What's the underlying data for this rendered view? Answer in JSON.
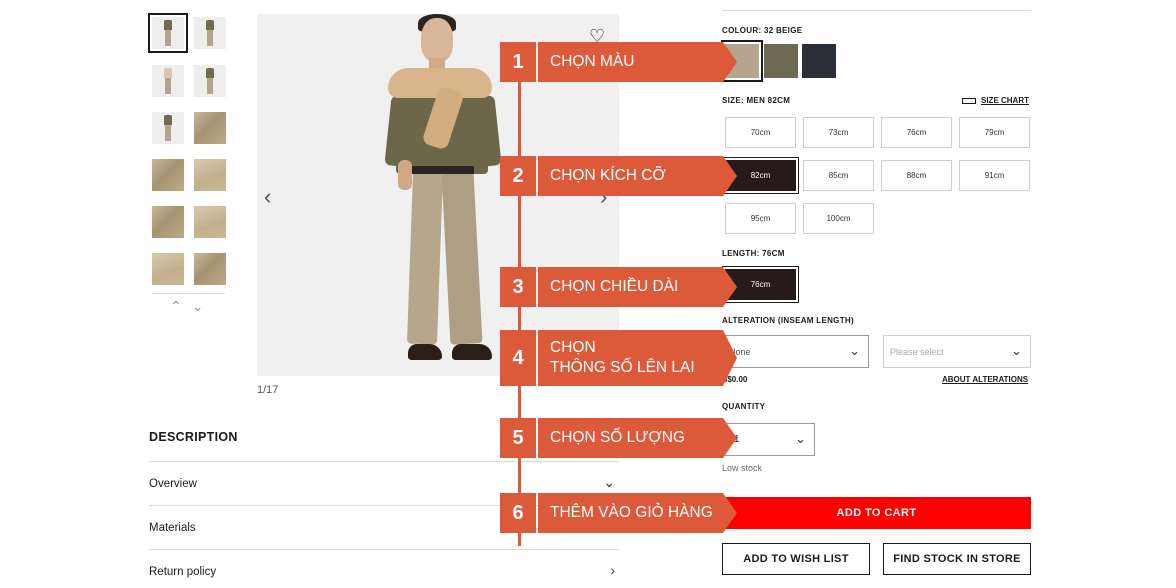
{
  "gallery": {
    "counter": "1/17",
    "scroll_up": "^",
    "scroll_down": "v",
    "prev_arrow": "‹",
    "next_arrow": "›",
    "wish_icon": "heart-plus-icon"
  },
  "description": {
    "title": "DESCRIPTION",
    "rows": [
      {
        "label": "Overview",
        "chevron": "⌄"
      },
      {
        "label": "Materials",
        "chevron": ""
      },
      {
        "label": "Return policy",
        "chevron": "›"
      }
    ]
  },
  "colour": {
    "label": "COLOUR: 32 BEIGE",
    "swatches": [
      {
        "name": "beige",
        "color": "#b5a590",
        "selected": true
      },
      {
        "name": "olive",
        "color": "#6d6a54",
        "selected": false
      },
      {
        "name": "navy",
        "color": "#2a2e38",
        "selected": false
      }
    ]
  },
  "size": {
    "label": "SIZE: MEN 82CM",
    "chart_link": "SIZE CHART",
    "options": [
      "70cm",
      "73cm",
      "76cm",
      "79cm",
      "82cm",
      "85cm",
      "88cm",
      "91cm",
      "95cm",
      "100cm"
    ],
    "selected": "82cm"
  },
  "length": {
    "label": "LENGTH: 76CM",
    "options": [
      "76cm"
    ],
    "selected": "76cm"
  },
  "alteration": {
    "label": "ALTERATION (INSEAM LENGTH)",
    "select_value": "None",
    "second_placeholder": "Please select",
    "price": "S$0.00",
    "about_link": "ABOUT ALTERATIONS"
  },
  "quantity": {
    "label": "QUANTITY",
    "value": "1",
    "stock_status": "Low stock"
  },
  "actions": {
    "add_to_cart": "ADD TO CART",
    "add_to_wish_list": "ADD TO WISH LIST",
    "find_stock": "FIND STOCK IN STORE"
  },
  "steps": [
    {
      "num": "1",
      "text": "CHỌN MÀU"
    },
    {
      "num": "2",
      "text": "CHỌN KÍCH CỠ"
    },
    {
      "num": "3",
      "text": "CHỌN CHIỀU DÀI"
    },
    {
      "num": "4",
      "text": "CHỌN\nTHÔNG SỐ LÊN LAI"
    },
    {
      "num": "5",
      "text": "CHỌN SỐ LƯỢNG"
    },
    {
      "num": "6",
      "text": "THÊM VÀO GIỎ HÀNG"
    }
  ],
  "colors": {
    "accent_red": "#ff0000",
    "step_orange": "#dc5a3a",
    "selected_chip": "#281a1a"
  }
}
